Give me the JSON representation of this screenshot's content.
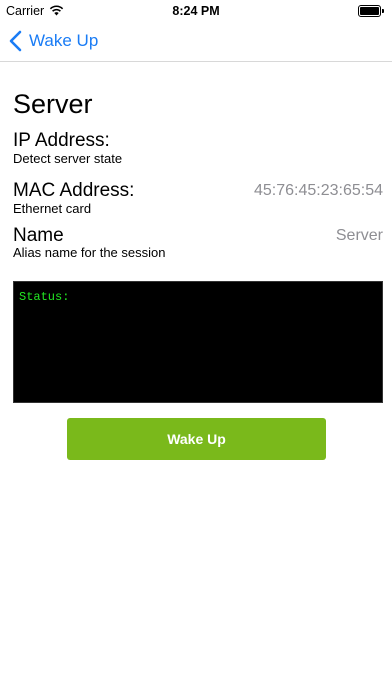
{
  "status_bar": {
    "carrier": "Carrier",
    "time": "8:24 PM",
    "wifi_icon": "wifi-icon",
    "battery_icon": "battery-icon",
    "battery_level": 1.0
  },
  "nav": {
    "back_label": "Wake Up",
    "back_icon": "chevron-left-icon",
    "accent_color": "#1a7cf5"
  },
  "main": {
    "title": "Server",
    "ip": {
      "label": "IP Address:",
      "subtitle": "Detect server state",
      "value": ""
    },
    "mac": {
      "label": "MAC Address:",
      "subtitle": "Ethernet card",
      "value": "45:76:45:23:65:54"
    },
    "name": {
      "label": "Name",
      "subtitle": "Alias name for the session",
      "value": "Server"
    },
    "console": {
      "status": "Status:",
      "text_color": "#22e622",
      "background": "#000000"
    },
    "wake_button": {
      "label": "Wake Up",
      "color": "#7ab91b"
    }
  }
}
